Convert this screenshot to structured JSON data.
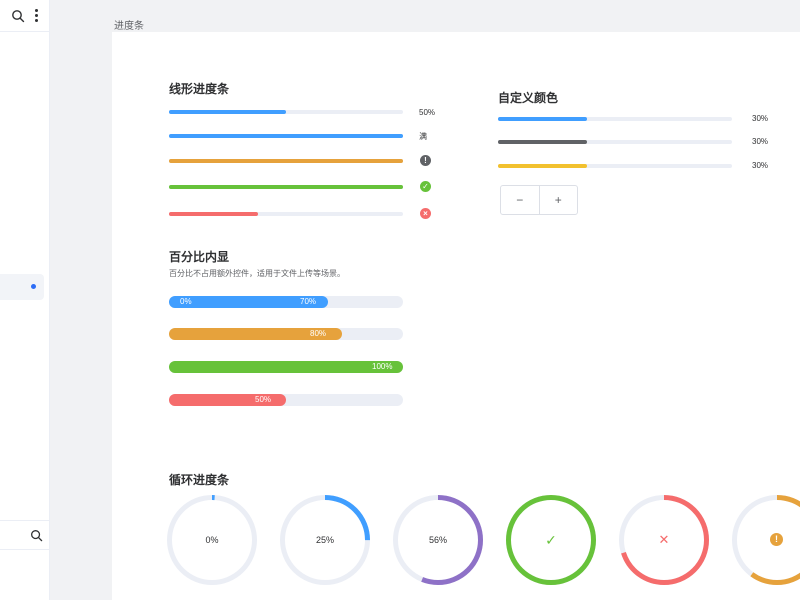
{
  "page": {
    "title": "进度条"
  },
  "colors": {
    "blue": "#409eff",
    "orange": "#e6a23c",
    "green": "#67c23a",
    "red": "#f56c6c",
    "purple": "#8e71c7",
    "gray": "#606266",
    "yellow": "#f2c12e",
    "track": "#ebeef5"
  },
  "linear": {
    "title": "线形进度条",
    "rows": [
      {
        "percent": 50,
        "color": "#409eff",
        "label": "50%"
      },
      {
        "percent": 100,
        "color": "#409eff",
        "label": "满"
      },
      {
        "percent": 100,
        "color": "#e6a23c",
        "icon": "warning-icon",
        "symbol": "!"
      },
      {
        "percent": 100,
        "color": "#67c23a",
        "icon": "success-icon",
        "symbol": "✓"
      },
      {
        "percent": 38,
        "color": "#f56c6c",
        "icon": "error-icon",
        "symbol": "×"
      }
    ]
  },
  "custom": {
    "title": "自定义颜色",
    "rows": [
      {
        "percent": 38,
        "color": "#409eff",
        "label": "30%"
      },
      {
        "percent": 38,
        "color": "#606266",
        "label": "30%"
      },
      {
        "percent": 38,
        "color": "#f2c12e",
        "label": "30%"
      }
    ],
    "minus_label": "−",
    "plus_label": "+"
  },
  "inner": {
    "title": "百分比内显",
    "desc": "百分比不占用额外控件，适用于文件上传等场景。",
    "rows": [
      {
        "percent": 68,
        "color": "#409eff",
        "start_label": "0%",
        "label": "70%"
      },
      {
        "percent": 74,
        "color": "#e6a23c",
        "label": "80%"
      },
      {
        "percent": 100,
        "color": "#67c23a",
        "label": "100%"
      },
      {
        "percent": 50,
        "color": "#f56c6c",
        "label": "50%"
      }
    ]
  },
  "circles": {
    "title": "循环进度条",
    "items": [
      {
        "percent": 1,
        "color": "#409eff",
        "label": "0%"
      },
      {
        "percent": 25,
        "color": "#409eff",
        "label": "25%"
      },
      {
        "percent": 56,
        "color": "#8e71c7",
        "label": "56%"
      },
      {
        "percent": 100,
        "color": "#67c23a",
        "icon": "check-icon",
        "symbol": "✓"
      },
      {
        "percent": 70,
        "color": "#f56c6c",
        "icon": "close-icon",
        "symbol": "✕"
      },
      {
        "percent": 60,
        "color": "#e6a23c",
        "icon": "warning-icon",
        "symbol": "!"
      }
    ]
  }
}
